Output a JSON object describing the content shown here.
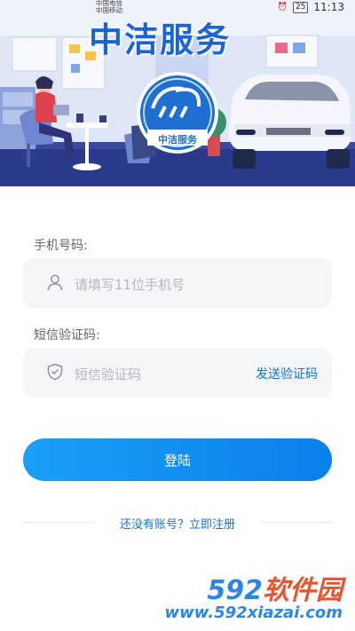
{
  "status_bar": {
    "carrier_1": "中国电信",
    "carrier_2": "中国移动",
    "time": "11:13",
    "battery": "25"
  },
  "header": {
    "app_title": "中洁服务",
    "logo_text": "中洁服务"
  },
  "form": {
    "phone_label": "手机号码:",
    "phone_placeholder": "请填写11位手机号",
    "code_label": "短信验证码:",
    "code_placeholder": "短信验证码",
    "send_code": "发送验证码",
    "login_button": "登陆",
    "register_link": "还没有账号？立即注册"
  },
  "watermark": {
    "number": "592",
    "brand": "软件园",
    "url": "www.592xiazai.com"
  },
  "colors": {
    "accent": "#1273d9",
    "button": "#0b7fec",
    "field_bg": "#f4f5f7"
  }
}
